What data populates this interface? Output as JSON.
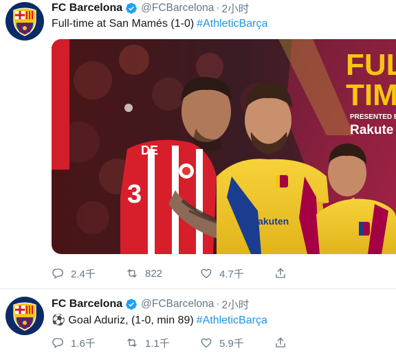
{
  "tweets": [
    {
      "name": "FC Barcelona",
      "handle": "@FCBarcelona",
      "separator": "·",
      "time": "2小时",
      "text": "Full-time at San Mamés (1-0)",
      "hashtag": "#AthleticBarça",
      "media": {
        "headline_line1": "FULL",
        "headline_line2": "TIME",
        "presented_by": "PRESENTED BY",
        "sponsor": "Rakute",
        "jersey_number": "3",
        "jersey_name": "DE",
        "kit_sponsor": "Rakuten",
        "club_crest_text": "FCB"
      },
      "stats": {
        "replies": "2.4千",
        "retweets": "822",
        "likes": "4.7千"
      }
    },
    {
      "name": "FC Barcelona",
      "handle": "@FCBarcelona",
      "separator": "·",
      "time": "2小时",
      "emoji": "⚽",
      "text": "Goal Aduriz, (1-0, min 89)",
      "hashtag": "#AthleticBarça",
      "stats": {
        "replies": "1.6千",
        "retweets": "1.1千",
        "likes": "5.9千"
      }
    }
  ],
  "icons": {
    "verified": "verified-badge-icon",
    "reply": "reply-icon",
    "retweet": "retweet-icon",
    "like": "like-icon",
    "share": "share-icon"
  },
  "colors": {
    "link": "#1b95e0",
    "verified": "#1da1f2",
    "muted": "#657786",
    "barca_blue": "#0b2a66",
    "barca_red": "#a50044",
    "barca_yellow": "#f6c514"
  }
}
